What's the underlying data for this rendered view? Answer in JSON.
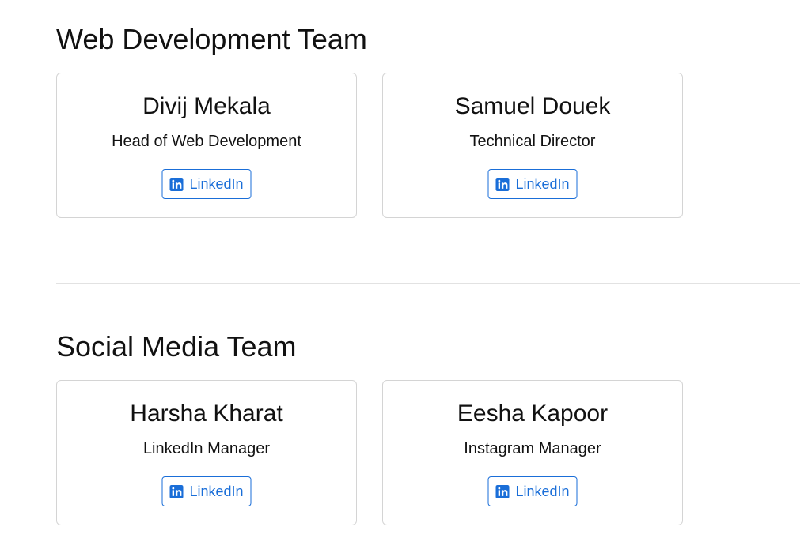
{
  "colors": {
    "accent": "#1a6ed8",
    "card_border": "#d4d4d4",
    "divider": "#e2e2e2",
    "text": "#111111"
  },
  "sections": [
    {
      "title": "Web Development Team",
      "members": [
        {
          "name": "Divij Mekala",
          "role": "Head of Web Development",
          "link_label": "LinkedIn",
          "icon": "linkedin-icon"
        },
        {
          "name": "Samuel Douek",
          "role": "Technical Director",
          "link_label": "LinkedIn",
          "icon": "linkedin-icon"
        }
      ]
    },
    {
      "title": "Social Media Team",
      "members": [
        {
          "name": "Harsha Kharat",
          "role": "LinkedIn Manager",
          "link_label": "LinkedIn",
          "icon": "linkedin-icon"
        },
        {
          "name": "Eesha Kapoor",
          "role": "Instagram Manager",
          "link_label": "LinkedIn",
          "icon": "linkedin-icon"
        }
      ]
    }
  ]
}
